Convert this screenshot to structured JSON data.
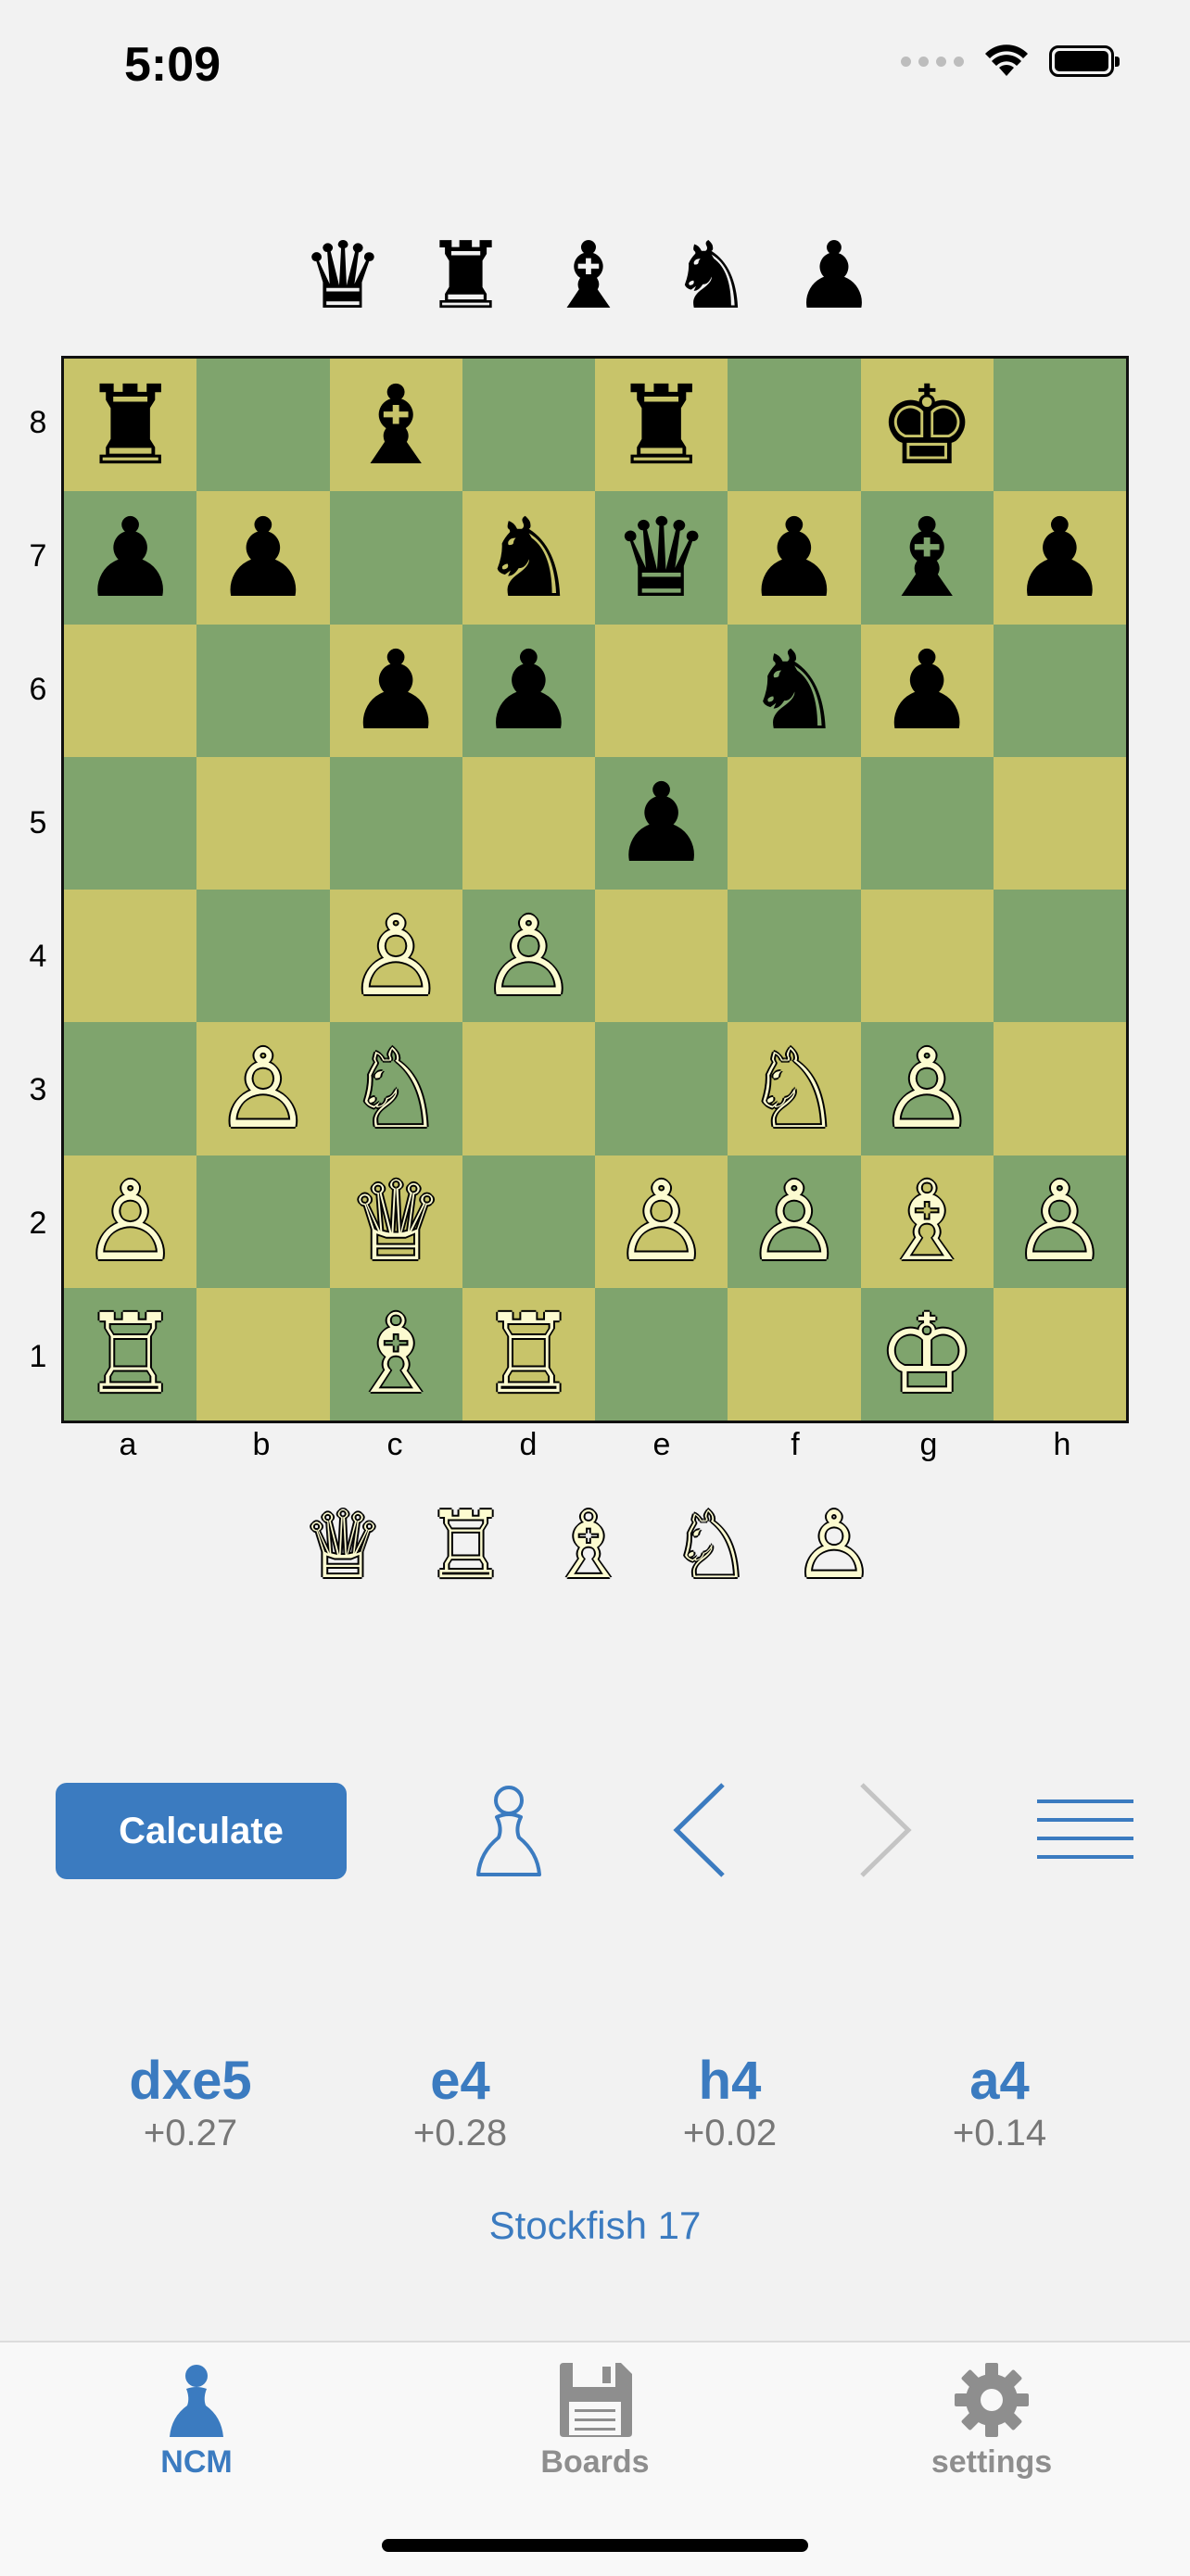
{
  "status_bar": {
    "time": "5:09"
  },
  "captured_black": [
    "♛",
    "♜",
    "♝",
    "♞",
    "♟"
  ],
  "captured_white": [
    "♕",
    "♖",
    "♗",
    "♘",
    "♙"
  ],
  "board": {
    "ranks": [
      "8",
      "7",
      "6",
      "5",
      "4",
      "3",
      "2",
      "1"
    ],
    "files": [
      "a",
      "b",
      "c",
      "d",
      "e",
      "f",
      "g",
      "h"
    ],
    "squares": [
      [
        "r",
        "",
        "b",
        "",
        "r",
        "",
        "k",
        ""
      ],
      [
        "p",
        "p",
        "",
        "n",
        "q",
        "p",
        "b",
        "p"
      ],
      [
        "",
        "",
        "p",
        "p",
        "",
        "n",
        "p",
        ""
      ],
      [
        "",
        "",
        "",
        "",
        "p",
        "",
        "",
        ""
      ],
      [
        "",
        "",
        "P",
        "P",
        "",
        "",
        "",
        ""
      ],
      [
        "",
        "P",
        "N",
        "",
        "",
        "N",
        "P",
        ""
      ],
      [
        "P",
        "",
        "Q",
        "",
        "P",
        "P",
        "B",
        "P"
      ],
      [
        "R",
        "",
        "B",
        "R",
        "",
        "",
        "K",
        ""
      ]
    ]
  },
  "controls": {
    "calculate_label": "Calculate",
    "side_icon": "pawn-outline-icon",
    "back_icon": "chevron-left-icon",
    "forward_icon": "chevron-right-icon",
    "menu_icon": "hamburger-menu-icon"
  },
  "analysis": {
    "moves": [
      {
        "san": "dxe5",
        "score": "+0.27"
      },
      {
        "san": "e4",
        "score": "+0.28"
      },
      {
        "san": "h4",
        "score": "+0.02"
      },
      {
        "san": "a4",
        "score": "+0.14"
      }
    ],
    "engine": "Stockfish 17"
  },
  "tabbar": {
    "tabs": [
      {
        "label": "NCM",
        "icon": "pawn-icon",
        "active": true
      },
      {
        "label": "Boards",
        "icon": "floppy-disk-icon",
        "active": false
      },
      {
        "label": "settings",
        "icon": "gear-icon",
        "active": false
      }
    ]
  },
  "colors": {
    "accent": "#3b7bc0",
    "light_square": "#c8c46a",
    "dark_square": "#7fa46d",
    "white_piece": "#fcfbd0",
    "inactive_tab": "#8e8e8e"
  }
}
